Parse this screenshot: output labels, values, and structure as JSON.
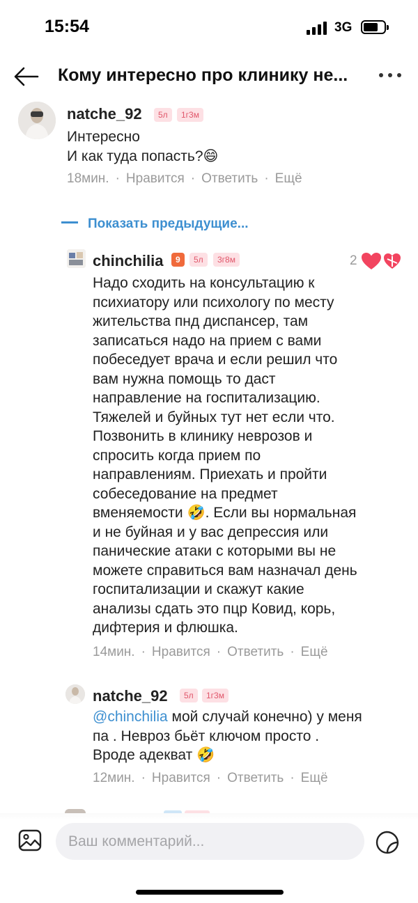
{
  "status_bar": {
    "time": "15:54",
    "network": "3G"
  },
  "header": {
    "title": "Кому интересно про клинику не...",
    "back_icon": "arrow-left-icon",
    "more_icon": "more-horizontal-icon"
  },
  "comments": [
    {
      "username": "natche_92",
      "badges": [
        "5л",
        "1г3м"
      ],
      "lines": [
        "Интересно",
        "И как туда попасть?😄"
      ],
      "time": "18мин.",
      "actions": [
        "Нравится",
        "Ответить",
        "Ещё"
      ]
    }
  ],
  "show_previous_label": "Показать предыдущие...",
  "replies": [
    {
      "username": "chinchilia",
      "level": "9",
      "badges": [
        "5л",
        "3г8м"
      ],
      "likes": "2",
      "lines": [
        "Надо сходить на консультацию к",
        "психиатору или психологу по месту",
        "жительства пнд диспансер, там",
        "записаться надо на прием с вами",
        "побеседует врача и если решил что",
        "вам нужна помощь то даст",
        "направление на госпитализацию.",
        "Тяжелей и буйных тут нет если что.",
        "Позвонить в клинику неврозов и",
        "спросить когда прием по",
        "направлениям. Приехать и пройти",
        "собеседование на предмет",
        "вменяемости 🤣. Если вы нормальная",
        "и не буйная и у вас депрессия или",
        "панические атаки с которыми вы не",
        "можете справиться вам назначал день",
        "госпитализации и скажут какие",
        "анализы сдать это пцр Ковид, корь,",
        "дифтерия и флюшка."
      ],
      "time": "14мин.",
      "actions": [
        "Нравится",
        "Ответить",
        "Ещё"
      ]
    },
    {
      "username": "natche_92",
      "badges": [
        "5л",
        "1г3м"
      ],
      "mention": "@chinchilia",
      "lines": [
        " мой случай конечно) у меня",
        "па . Невроз бьёт ключом просто .",
        "Вроде адекват 🤣"
      ],
      "time": "12мин.",
      "actions": [
        "Нравится",
        "Ответить",
        "Ещё"
      ]
    }
  ],
  "composer": {
    "placeholder": "Ваш комментарий...",
    "image_icon": "image-icon",
    "sticker_icon": "sticker-icon"
  },
  "colors": {
    "accent": "#3d8fd0",
    "like": "#f2445f",
    "badge_bg": "#fde0e4",
    "badge_text": "#e0566a",
    "level_badge": "#f06a3b"
  }
}
